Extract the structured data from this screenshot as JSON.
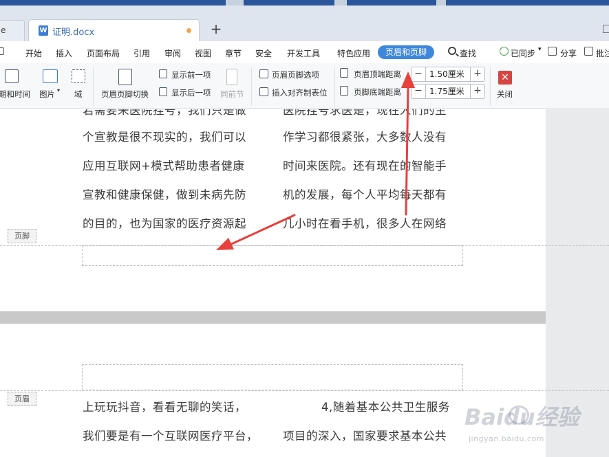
{
  "tabs": {
    "prev_tab_label": "e",
    "doc_tab_label": "证明.docx",
    "doc_icon_letter": "W",
    "add_tab_label": "+"
  },
  "menu": {
    "items": [
      "开始",
      "插入",
      "页面布局",
      "引用",
      "审阅",
      "视图",
      "章节",
      "安全",
      "开发工具",
      "特色应用"
    ],
    "active": "页眉和页脚",
    "search_label": "查找",
    "sync_label": "已同步",
    "share_label": "分享",
    "comment_label": "批注"
  },
  "ribbon": {
    "date_time_label": "期和时间",
    "picture_label": "图片",
    "field_label": "域",
    "switch_label": "页眉页脚切换",
    "show_prev_label": "显示前一项",
    "show_next_label": "显示后一项",
    "same_as_prev_label": "同前节",
    "hf_options_label": "页眉页脚选项",
    "insert_tab_label": "插入对齐制表位",
    "header_top_distance_label": "页眉顶端距离",
    "footer_bottom_distance_label": "页脚底端距离",
    "header_distance_value": "1.50厘米",
    "footer_distance_value": "1.75厘米",
    "close_label": "关闭",
    "minus": "−",
    "plus": "+"
  },
  "document": {
    "page1_left_lines": [
      "个宣教是很不现实的，我们可以",
      "应用互联网+模式帮助患者健康",
      "宣教和健康保健，做到未病先防",
      "的目的，也为国家的医疗资源起"
    ],
    "page1_right_lines": [
      "作学习都很紧张，大多数人没有",
      "时间来医院。还有现在的智能手",
      "机的发展，每个人平均每天都有",
      "几小时在看手机，很多人在网络"
    ],
    "page1_left_partial": "若需要来医院挂号，我们只是做",
    "page1_right_partial": "医院挂号求医是，现在人们的生",
    "footer_tag": "页脚",
    "header_tag": "页眉",
    "page2_left_lines": [
      "上玩玩抖音，看看无聊的笑话，",
      "我们要是有一个互联网医疗平台，"
    ],
    "page2_right_lines": [
      "4,随着基本公共卫生服务",
      "项目的深入，国家要求基本公共"
    ]
  },
  "watermark": {
    "brand": "Baidu经验",
    "url": "jingyan.baidu.com"
  },
  "colors": {
    "accent": "#3f87db",
    "arrow": "#e8403c",
    "close": "#d64541"
  }
}
